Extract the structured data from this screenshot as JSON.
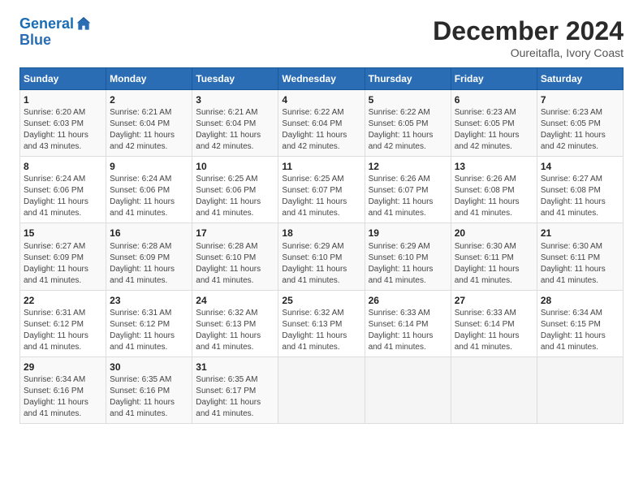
{
  "logo": {
    "line1": "General",
    "line2": "Blue"
  },
  "title": "December 2024",
  "subtitle": "Oureitafla, Ivory Coast",
  "days_header": [
    "Sunday",
    "Monday",
    "Tuesday",
    "Wednesday",
    "Thursday",
    "Friday",
    "Saturday"
  ],
  "weeks": [
    [
      {
        "day": "1",
        "sunrise": "6:20 AM",
        "sunset": "6:03 PM",
        "daylight": "11 hours and 43 minutes."
      },
      {
        "day": "2",
        "sunrise": "6:21 AM",
        "sunset": "6:04 PM",
        "daylight": "11 hours and 42 minutes."
      },
      {
        "day": "3",
        "sunrise": "6:21 AM",
        "sunset": "6:04 PM",
        "daylight": "11 hours and 42 minutes."
      },
      {
        "day": "4",
        "sunrise": "6:22 AM",
        "sunset": "6:04 PM",
        "daylight": "11 hours and 42 minutes."
      },
      {
        "day": "5",
        "sunrise": "6:22 AM",
        "sunset": "6:05 PM",
        "daylight": "11 hours and 42 minutes."
      },
      {
        "day": "6",
        "sunrise": "6:23 AM",
        "sunset": "6:05 PM",
        "daylight": "11 hours and 42 minutes."
      },
      {
        "day": "7",
        "sunrise": "6:23 AM",
        "sunset": "6:05 PM",
        "daylight": "11 hours and 42 minutes."
      }
    ],
    [
      {
        "day": "8",
        "sunrise": "6:24 AM",
        "sunset": "6:06 PM",
        "daylight": "11 hours and 41 minutes."
      },
      {
        "day": "9",
        "sunrise": "6:24 AM",
        "sunset": "6:06 PM",
        "daylight": "11 hours and 41 minutes."
      },
      {
        "day": "10",
        "sunrise": "6:25 AM",
        "sunset": "6:06 PM",
        "daylight": "11 hours and 41 minutes."
      },
      {
        "day": "11",
        "sunrise": "6:25 AM",
        "sunset": "6:07 PM",
        "daylight": "11 hours and 41 minutes."
      },
      {
        "day": "12",
        "sunrise": "6:26 AM",
        "sunset": "6:07 PM",
        "daylight": "11 hours and 41 minutes."
      },
      {
        "day": "13",
        "sunrise": "6:26 AM",
        "sunset": "6:08 PM",
        "daylight": "11 hours and 41 minutes."
      },
      {
        "day": "14",
        "sunrise": "6:27 AM",
        "sunset": "6:08 PM",
        "daylight": "11 hours and 41 minutes."
      }
    ],
    [
      {
        "day": "15",
        "sunrise": "6:27 AM",
        "sunset": "6:09 PM",
        "daylight": "11 hours and 41 minutes."
      },
      {
        "day": "16",
        "sunrise": "6:28 AM",
        "sunset": "6:09 PM",
        "daylight": "11 hours and 41 minutes."
      },
      {
        "day": "17",
        "sunrise": "6:28 AM",
        "sunset": "6:10 PM",
        "daylight": "11 hours and 41 minutes."
      },
      {
        "day": "18",
        "sunrise": "6:29 AM",
        "sunset": "6:10 PM",
        "daylight": "11 hours and 41 minutes."
      },
      {
        "day": "19",
        "sunrise": "6:29 AM",
        "sunset": "6:10 PM",
        "daylight": "11 hours and 41 minutes."
      },
      {
        "day": "20",
        "sunrise": "6:30 AM",
        "sunset": "6:11 PM",
        "daylight": "11 hours and 41 minutes."
      },
      {
        "day": "21",
        "sunrise": "6:30 AM",
        "sunset": "6:11 PM",
        "daylight": "11 hours and 41 minutes."
      }
    ],
    [
      {
        "day": "22",
        "sunrise": "6:31 AM",
        "sunset": "6:12 PM",
        "daylight": "11 hours and 41 minutes."
      },
      {
        "day": "23",
        "sunrise": "6:31 AM",
        "sunset": "6:12 PM",
        "daylight": "11 hours and 41 minutes."
      },
      {
        "day": "24",
        "sunrise": "6:32 AM",
        "sunset": "6:13 PM",
        "daylight": "11 hours and 41 minutes."
      },
      {
        "day": "25",
        "sunrise": "6:32 AM",
        "sunset": "6:13 PM",
        "daylight": "11 hours and 41 minutes."
      },
      {
        "day": "26",
        "sunrise": "6:33 AM",
        "sunset": "6:14 PM",
        "daylight": "11 hours and 41 minutes."
      },
      {
        "day": "27",
        "sunrise": "6:33 AM",
        "sunset": "6:14 PM",
        "daylight": "11 hours and 41 minutes."
      },
      {
        "day": "28",
        "sunrise": "6:34 AM",
        "sunset": "6:15 PM",
        "daylight": "11 hours and 41 minutes."
      }
    ],
    [
      {
        "day": "29",
        "sunrise": "6:34 AM",
        "sunset": "6:16 PM",
        "daylight": "11 hours and 41 minutes."
      },
      {
        "day": "30",
        "sunrise": "6:35 AM",
        "sunset": "6:16 PM",
        "daylight": "11 hours and 41 minutes."
      },
      {
        "day": "31",
        "sunrise": "6:35 AM",
        "sunset": "6:17 PM",
        "daylight": "11 hours and 41 minutes."
      },
      null,
      null,
      null,
      null
    ]
  ]
}
